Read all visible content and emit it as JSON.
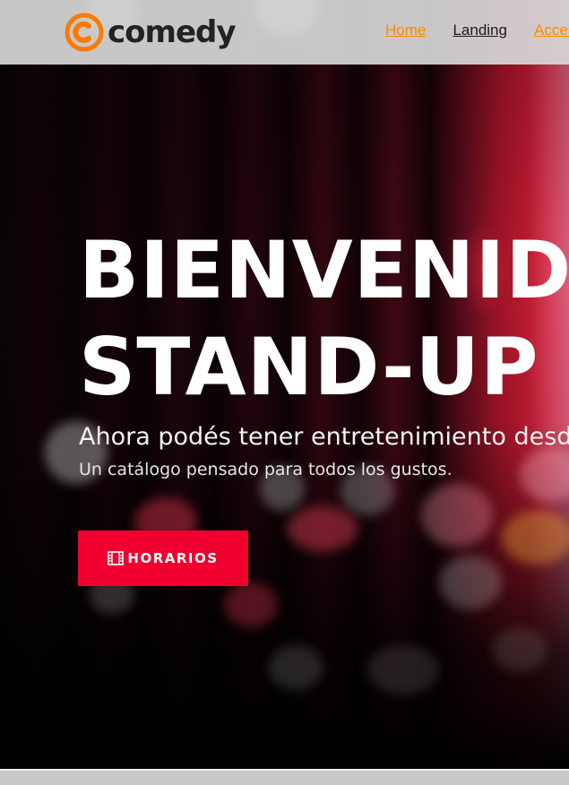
{
  "brand": {
    "name": "comedy",
    "logo_color": "#ff7a00"
  },
  "nav": {
    "items": [
      {
        "label": "Home",
        "color": "#ff8a00"
      },
      {
        "label": "Landing",
        "color": "#1b1b1b"
      },
      {
        "label": "Acceso",
        "color": "#ff8a00"
      }
    ]
  },
  "hero": {
    "title_line1": "BIENVENIDOS",
    "title_line2": "STAND-UP",
    "subtitle": "Ahora podés tener entretenimiento desde tu casa",
    "text": "Un catálogo pensado para todos los gustos.",
    "cta_label": "HORARIOS",
    "cta_icon": "film-icon",
    "cta_color": "#f0002e"
  }
}
